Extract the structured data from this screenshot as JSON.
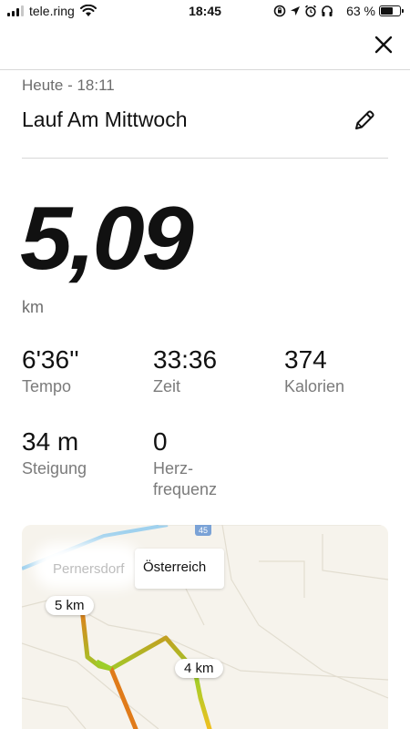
{
  "status_bar": {
    "carrier": "tele.ring",
    "time": "18:45",
    "battery": "63 %",
    "battery_level": 0.63,
    "signal_bars": 3
  },
  "header": {
    "close_icon": "close-icon"
  },
  "activity": {
    "date": "Heute - 18:11",
    "title": "Lauf Am Mittwoch",
    "edit_icon": "pencil-icon",
    "distance": "5,09",
    "distance_unit": "km"
  },
  "stats": [
    {
      "value": "6'36''",
      "label": "Tempo"
    },
    {
      "value": "33:36",
      "label": "Zeit"
    },
    {
      "value": "374",
      "label": "Kalorien"
    },
    {
      "value": "34 m",
      "label": "Steigung"
    },
    {
      "value": "0",
      "label": "Herz-\nfrequenz"
    }
  ],
  "map": {
    "place_name": "Pernersdorf",
    "country": "Österreich",
    "road_number": "45",
    "markers": [
      "5 km",
      "4 km"
    ],
    "colors": {
      "route_start": "#e07b1a",
      "route_mid": "#9ccf2a",
      "route_end": "#f0c020",
      "water": "#9fd1ee"
    }
  }
}
